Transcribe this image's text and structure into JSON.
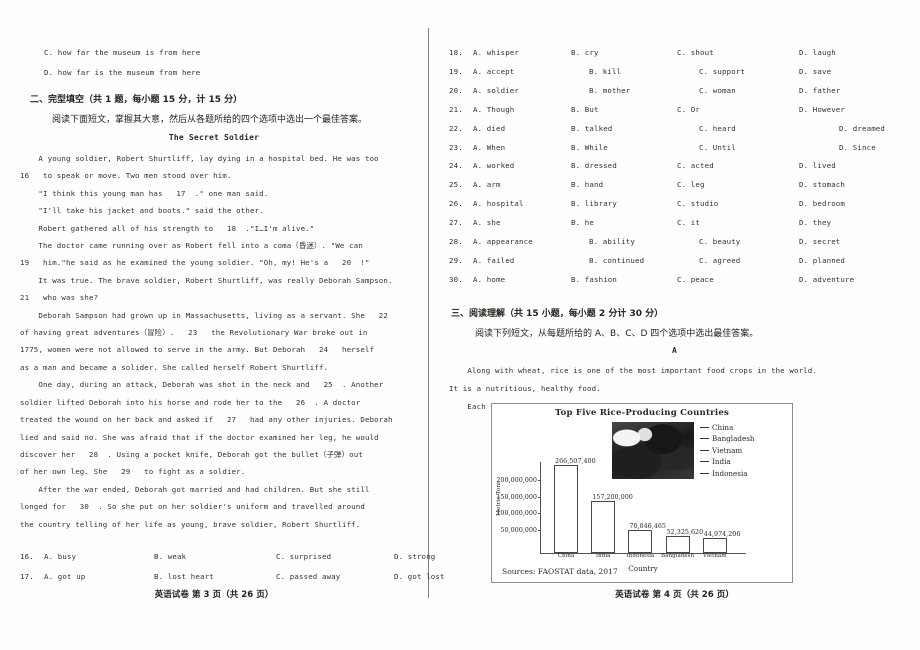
{
  "left_page": {
    "carryover_options": [
      "C. how far the museum is from here",
      "D. how far is the museum from here"
    ],
    "section_heading": "二、完型填空（共 1 题，每小题 15 分，计 15 分）",
    "section_instruction": "阅读下面短文，掌握其大意，然后从各题所给的四个选项中选出一个最佳答案。",
    "passage_title": "The Secret Soldier",
    "passage_lines": [
      "    A young soldier, Robert Shurtliff, lay dying in a hospital bed. He was too",
      "16   to speak or move. Two men stood over him.",
      "    \"I think this young man has   17  .\" one man said.",
      "    \"I'll take his jacket and boots.\" said the other.",
      "    Robert gathered all of his strength to   18  .\"I…I'm alive.\"",
      "    The doctor came running over as Robert fell into a coma（昏迷）. \"We can",
      "19   him.\"he said as he examined the young soldier. \"Oh, my! He's a   20  !\"",
      "    It was true. The brave soldier, Robert Shurtliff, was really Deborah Sampson.",
      "21   who was she?",
      "    Deborah Sampson had grown up in Massachusetts, living as a servant. She   22",
      "of having great adventures（冒险）.   23   the Revolutionary War broke out in",
      "1775, women were not allowed to serve in the army. But Deborah   24   herself",
      "as a man and became a solider. She called herself Robert Shurtliff.",
      "    One day, during an attack, Deborah was shot in the neck and   25  . Another",
      "soldier lifted Deborah into his horse and rode her to the   26  . A doctor",
      "treated the wound on her back and asked if   27   had any other injuries. Deborah",
      "lied and said no. She was afraid that if the doctor examined her leg, he would",
      "discover her   28  . Using a pocket knife, Deborah got the bullet（子弹）out",
      "of her own leg. She   29   to fight as a soldier.",
      "    After the war ended, Deborah got married and had children. But she still",
      "longed for   30  . So she put on her soldier's uniform and travelled around",
      "the country telling of her life as young, brave soldier, Robert Shurtliff."
    ],
    "questions": [
      {
        "num": "16.",
        "a": "A. busy",
        "b": "B. weak",
        "c": "C. surprised",
        "d": "D. strong"
      },
      {
        "num": "17.",
        "a": "A. got up",
        "b": "B. lost heart",
        "c": "C. passed away",
        "d": "D. got lost"
      }
    ],
    "footer": "英语试卷  第 3 页（共 26 页）"
  },
  "right_page": {
    "questions": [
      {
        "num": "18.",
        "a": "A. whisper",
        "b": "B. cry",
        "c": "C. shout",
        "d": "D. laugh",
        "layout": "w"
      },
      {
        "num": "19.",
        "a": "A. accept",
        "b": "B. kill",
        "c": "C. support",
        "d": "D. save",
        "layout": "n"
      },
      {
        "num": "20.",
        "a": "A. soldier",
        "b": "B. mother",
        "c": "C. woman",
        "d": "D. father",
        "layout": "n"
      },
      {
        "num": "21.",
        "a": "A. Though",
        "b": "B. But",
        "c": "C. Or",
        "d": "D. However",
        "layout": "w"
      },
      {
        "num": "22.",
        "a": "A. died",
        "b": "B. talked",
        "c": "C. heard",
        "d": "D. dreamed",
        "layout": "f"
      },
      {
        "num": "23.",
        "a": "A. When",
        "b": "B. While",
        "c": "C. Until",
        "d": "D. Since",
        "layout": "f"
      },
      {
        "num": "24.",
        "a": "A. worked",
        "b": "B. dressed",
        "c": "C. acted",
        "d": "D. lived",
        "layout": "w"
      },
      {
        "num": "25.",
        "a": "A. arm",
        "b": "B. hand",
        "c": "C. leg",
        "d": "D. stomach",
        "layout": "w"
      },
      {
        "num": "26.",
        "a": "A. hospital",
        "b": "B. library",
        "c": "C. studio",
        "d": "D. bedroom",
        "layout": "w"
      },
      {
        "num": "27.",
        "a": "A. she",
        "b": "B. he",
        "c": "C. it",
        "d": "D. they",
        "layout": "w"
      },
      {
        "num": "28.",
        "a": "A. appearance",
        "b": "B. ability",
        "c": "C. beauty",
        "d": "D. secret",
        "layout": "n"
      },
      {
        "num": "29.",
        "a": "A. failed",
        "b": "B. continued",
        "c": "C. agreed",
        "d": "D. planned",
        "layout": "n"
      },
      {
        "num": "30.",
        "a": "A. home",
        "b": "B. fashion",
        "c": "C. peace",
        "d": "D. adventure",
        "layout": "w"
      }
    ],
    "section_heading": "三、阅读理解（共 15 小题，每小题 2 分计 30 分）",
    "section_instruction": "阅读下列短文，从每题所给的 A、B、C、D 四个选项中选出最佳答案。",
    "passage_label": "A",
    "passage_lines": [
      "    Along with wheat, rice is one of the most important food crops in the world.",
      "It is a nutritious, healthy food.",
      "    Each year, farmers grow millions of tons of rice."
    ],
    "footer": "英语试卷  第 4 页（共 26 页）"
  },
  "chart_data": {
    "type": "bar",
    "title": "Top Five Rice-Producing Countries",
    "xlabel": "Country",
    "ylabel": "Metric Tons",
    "categories": [
      "China",
      "India",
      "Indonesia",
      "Bangladesh",
      "Vietnam"
    ],
    "values": [
      266507400,
      157200000,
      70846465,
      52325620,
      44974206
    ],
    "value_labels": [
      "266,507,400",
      "157,200,000",
      "70,846,465",
      "52,325,620",
      "44,974,206"
    ],
    "ylim": [
      0,
      280000000
    ],
    "yticks": [
      50000000,
      100000000,
      150000000,
      200000000
    ],
    "ytick_labels": [
      "50,000,000",
      "100,000,000",
      "150,000,000",
      "200,000,000"
    ],
    "grid": false,
    "legend_position": "top-right",
    "legend": [
      "China",
      "Bangladesh",
      "Vietnam",
      "India",
      "Indonesia"
    ],
    "map_inset": "world-map-thumbnail",
    "source": "Sources: FAOSTAT data, 2017"
  }
}
